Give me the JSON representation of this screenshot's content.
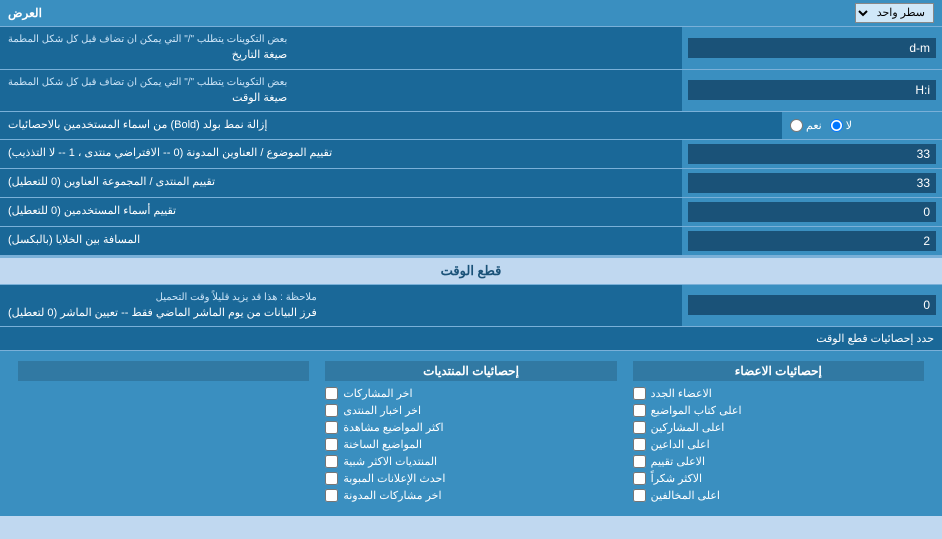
{
  "header": {
    "display_label": "العرض",
    "display_option": "سطر واحد"
  },
  "date_format": {
    "label": "صيغة التاريخ",
    "sublabel": "بعض التكوينات يتطلب \"/\" التي يمكن ان تضاف قبل كل شكل المطمة",
    "value": "d-m"
  },
  "time_format": {
    "label": "صيغة الوقت",
    "sublabel": "بعض التكوينات يتطلب \"/\" التي يمكن ان تضاف قبل كل شكل المطمة",
    "value": "H:i"
  },
  "bold_remove": {
    "label": "إزالة نمط بولد (Bold) من اسماء المستخدمين بالاحصائيات",
    "option_yes": "نعم",
    "option_no": "لا",
    "selected": "no"
  },
  "topic_sort": {
    "label": "تقييم الموضوع / العناوين المدونة (0 -- الافتراضي منتدى ، 1 -- لا التذذيب)",
    "value": "33"
  },
  "forum_sort": {
    "label": "تقييم المنتدى / المجموعة العناوين (0 للتعطيل)",
    "value": "33"
  },
  "user_sort": {
    "label": "تقييم أسماء المستخدمين (0 للتعطيل)",
    "value": "0"
  },
  "cell_spacing": {
    "label": "المسافة بين الخلايا (بالبكسل)",
    "value": "2"
  },
  "time_section": {
    "header": "قطع الوقت"
  },
  "time_filter": {
    "label": "فرز البيانات من يوم الماشر الماضي فقط -- تعيين الماشر (0 لتعطيل)",
    "sublabel": "ملاحظة : هذا قد يزيد قليلاً وقت التحميل",
    "value": "0"
  },
  "limit_stats": {
    "label": "حدد إحصائيات قطع الوقت"
  },
  "checkboxes": {
    "col1_header": "إحصائيات الاعضاء",
    "col2_header": "إحصائيات المنتديات",
    "col3_header": "",
    "col1_items": [
      {
        "label": "الاعضاء الجدد",
        "checked": false
      },
      {
        "label": "اعلى كتاب المواضيع",
        "checked": false
      },
      {
        "label": "اعلى المشاركين",
        "checked": false
      },
      {
        "label": "اعلى الداعين",
        "checked": false
      },
      {
        "label": "الاعلى تقييم",
        "checked": false
      },
      {
        "label": "الاكثر شكراً",
        "checked": false
      },
      {
        "label": "اعلى المخالفين",
        "checked": false
      }
    ],
    "col2_items": [
      {
        "label": "اخر المشاركات",
        "checked": false
      },
      {
        "label": "اخر اخبار المنتدى",
        "checked": false
      },
      {
        "label": "اكثر المواضيع مشاهدة",
        "checked": false
      },
      {
        "label": "المواضيع الساخنة",
        "checked": false
      },
      {
        "label": "المنتديات الاكثر شبية",
        "checked": false
      },
      {
        "label": "احدث الإعلانات المبوبة",
        "checked": false
      },
      {
        "label": "اخر مشاركات المدونة",
        "checked": false
      }
    ],
    "col3_items": []
  }
}
